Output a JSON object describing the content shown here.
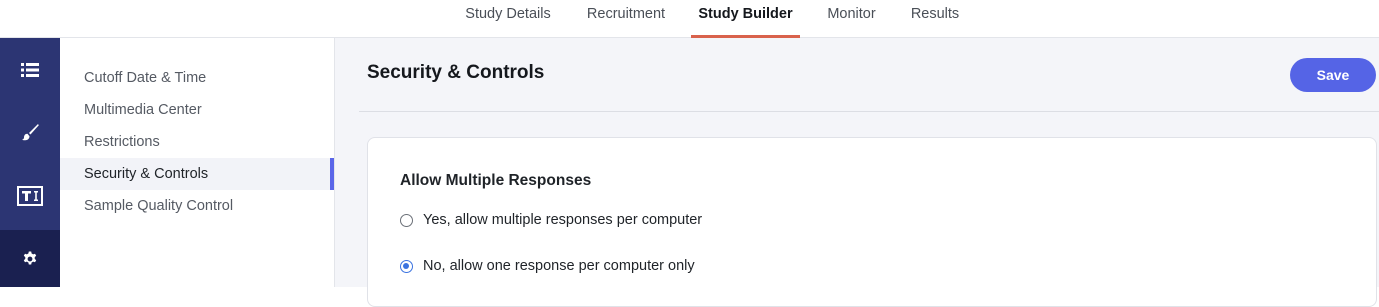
{
  "tabs": [
    {
      "label": "Study Details",
      "active": false
    },
    {
      "label": "Recruitment",
      "active": false
    },
    {
      "label": "Study Builder",
      "active": true
    },
    {
      "label": "Monitor",
      "active": false
    },
    {
      "label": "Results",
      "active": false
    }
  ],
  "rail": [
    {
      "icon": "list-icon",
      "active": false
    },
    {
      "icon": "brush-icon",
      "active": false
    },
    {
      "icon": "text-tool-icon",
      "active": false
    },
    {
      "icon": "gear-icon",
      "active": true
    }
  ],
  "subnav": [
    {
      "label": "Cutoff Date & Time",
      "active": false
    },
    {
      "label": "Multimedia Center",
      "active": false
    },
    {
      "label": "Restrictions",
      "active": false
    },
    {
      "label": "Security & Controls",
      "active": true
    },
    {
      "label": "Sample Quality Control",
      "active": false
    }
  ],
  "main": {
    "title": "Security & Controls",
    "save_label": "Save",
    "section": {
      "title": "Allow Multiple Responses",
      "options": [
        {
          "label": "Yes, allow multiple responses per computer",
          "checked": false
        },
        {
          "label": "No, allow one response per computer only",
          "checked": true
        }
      ]
    }
  },
  "colors": {
    "accent": "#5564e6",
    "tab_underline": "#d9624c",
    "rail_bg": "#2c3573",
    "rail_active": "#1a2050",
    "radio_checked": "#3b73e0"
  }
}
